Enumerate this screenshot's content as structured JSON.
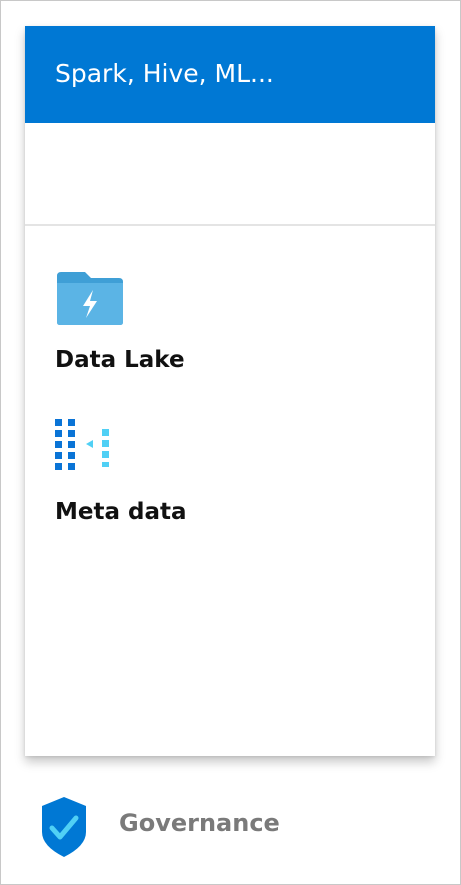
{
  "card": {
    "title": "Spark, Hive, ML...",
    "items": [
      {
        "label": "Data Lake",
        "icon": "data-lake-folder-icon"
      },
      {
        "label": "Meta data",
        "icon": "metadata-grid-icon"
      }
    ]
  },
  "footer": {
    "label": "Governance",
    "icon": "shield-check-icon"
  },
  "colors": {
    "header": "#0078d4",
    "folder": "#5bb4e5",
    "metadata_dark": "#0a74d6",
    "metadata_light": "#50d0f5",
    "shield": "#0078d4",
    "check": "#50d0f5"
  }
}
